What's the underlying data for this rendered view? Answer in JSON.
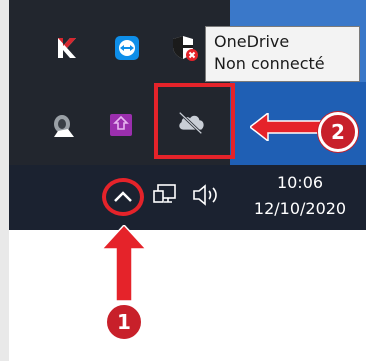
{
  "tooltip": {
    "line1": "OneDrive",
    "line2": "Non connecté"
  },
  "clock": {
    "time": "10:06",
    "date": "12/10/2020"
  },
  "badges": {
    "step1": "1",
    "step2": "2"
  },
  "tray_icons": [
    "kaspersky-icon",
    "teamviewer-icon",
    "shield-icon",
    "speaker-icon",
    "purple-app-icon",
    "onedrive-cloud-icon"
  ],
  "taskbar_icons": [
    "up-chevron-icon",
    "network-icon",
    "volume-icon"
  ],
  "colors": {
    "annotation_red": "#e5232a",
    "taskbar_dark": "#1b2230",
    "tray_blue": "#1f5fb4"
  }
}
